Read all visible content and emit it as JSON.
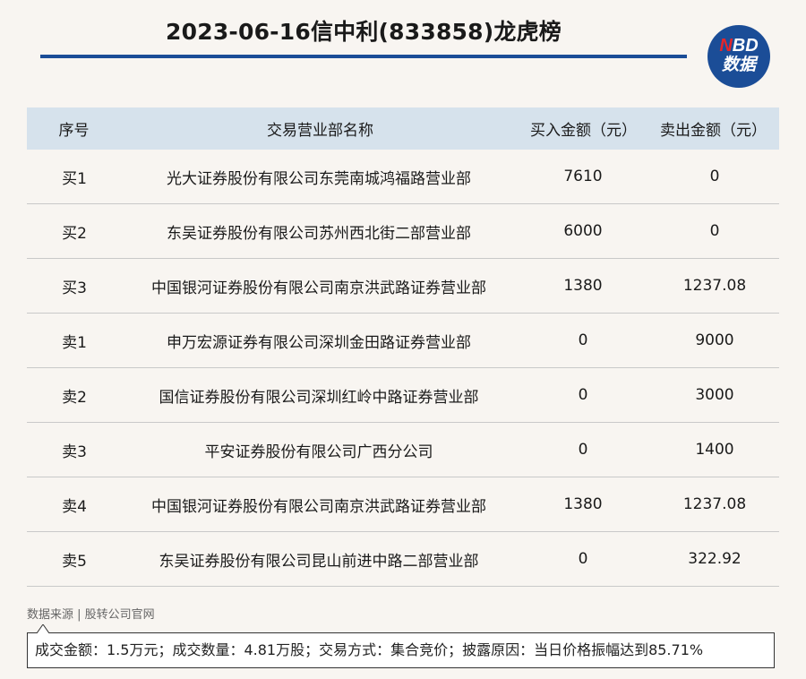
{
  "header": {
    "title": "2023-06-16信中利(833858)龙虎榜"
  },
  "logo": {
    "letter_n": "N",
    "letters_bd": "BD",
    "subtitle": "数据",
    "accent_color": "#e4262b",
    "brand_color": "#1b4d97"
  },
  "table": {
    "columns": [
      "序号",
      "交易营业部名称",
      "买入金额（元）",
      "卖出金额（元）"
    ],
    "rows": [
      [
        "买1",
        "光大证券股份有限公司东莞南城鸿福路营业部",
        "7610",
        "0"
      ],
      [
        "买2",
        "东吴证券股份有限公司苏州西北街二部营业部",
        "6000",
        "0"
      ],
      [
        "买3",
        "中国银河证券股份有限公司南京洪武路证券营业部",
        "1380",
        "1237.08"
      ],
      [
        "卖1",
        "申万宏源证券有限公司深圳金田路证券营业部",
        "0",
        "9000"
      ],
      [
        "卖2",
        "国信证券股份有限公司深圳红岭中路证券营业部",
        "0",
        "3000"
      ],
      [
        "卖3",
        "平安证券股份有限公司广西分公司",
        "0",
        "1400"
      ],
      [
        "卖4",
        "中国银河证券股份有限公司南京洪武路证券营业部",
        "1380",
        "1237.08"
      ],
      [
        "卖5",
        "东吴证券股份有限公司昆山前进中路二部营业部",
        "0",
        "322.92"
      ]
    ]
  },
  "footer": {
    "source": "数据来源 | 股转公司官网",
    "note": "成交金额：1.5万元；成交数量：4.81万股；交易方式：集合竞价；披露原因：当日价格振幅达到85.71%"
  }
}
